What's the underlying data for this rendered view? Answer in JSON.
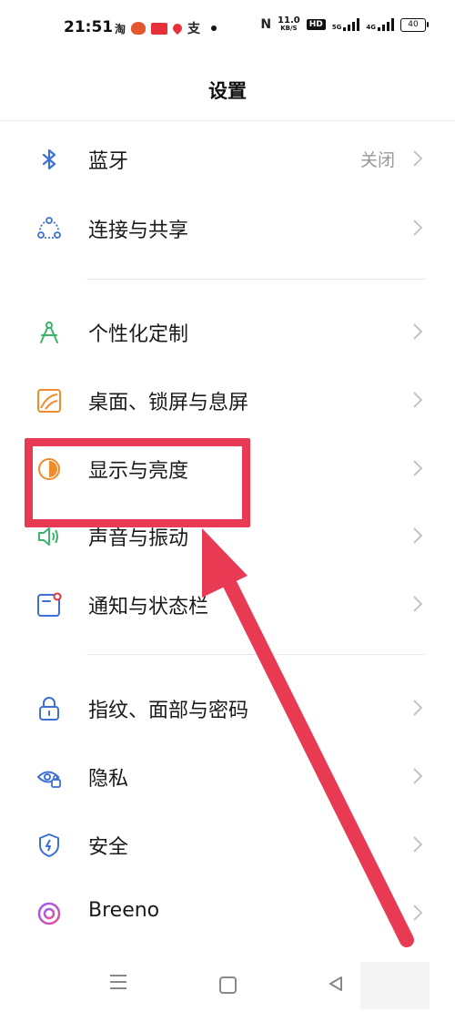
{
  "status_bar": {
    "time": "21:51",
    "net_speed": "11.0",
    "net_unit": "KB/S",
    "hd_label": "HD",
    "net1": "5G",
    "net2": "4G",
    "battery": "40"
  },
  "header": {
    "title": "设置"
  },
  "settings": [
    {
      "label": "蓝牙",
      "value": "关闭",
      "icon": "bluetooth-icon"
    },
    {
      "label": "连接与共享",
      "icon": "share-icon"
    },
    {
      "label": "个性化定制",
      "icon": "compass-icon"
    },
    {
      "label": "桌面、锁屏与息屏",
      "icon": "wallpaper-icon"
    },
    {
      "label": "显示与亮度",
      "icon": "brightness-icon"
    },
    {
      "label": "声音与振动",
      "icon": "speaker-icon"
    },
    {
      "label": "通知与状态栏",
      "icon": "notification-icon"
    },
    {
      "label": "指纹、面部与密码",
      "icon": "lock-icon"
    },
    {
      "label": "隐私",
      "icon": "privacy-eye-icon"
    },
    {
      "label": "安全",
      "icon": "shield-icon"
    },
    {
      "label": "Breeno",
      "icon": "breeno-icon"
    }
  ],
  "colors": {
    "accent_red": "#e83a53",
    "bluetooth_blue": "#3d6fd6",
    "green": "#3bb36a",
    "orange": "#f08a2b"
  }
}
